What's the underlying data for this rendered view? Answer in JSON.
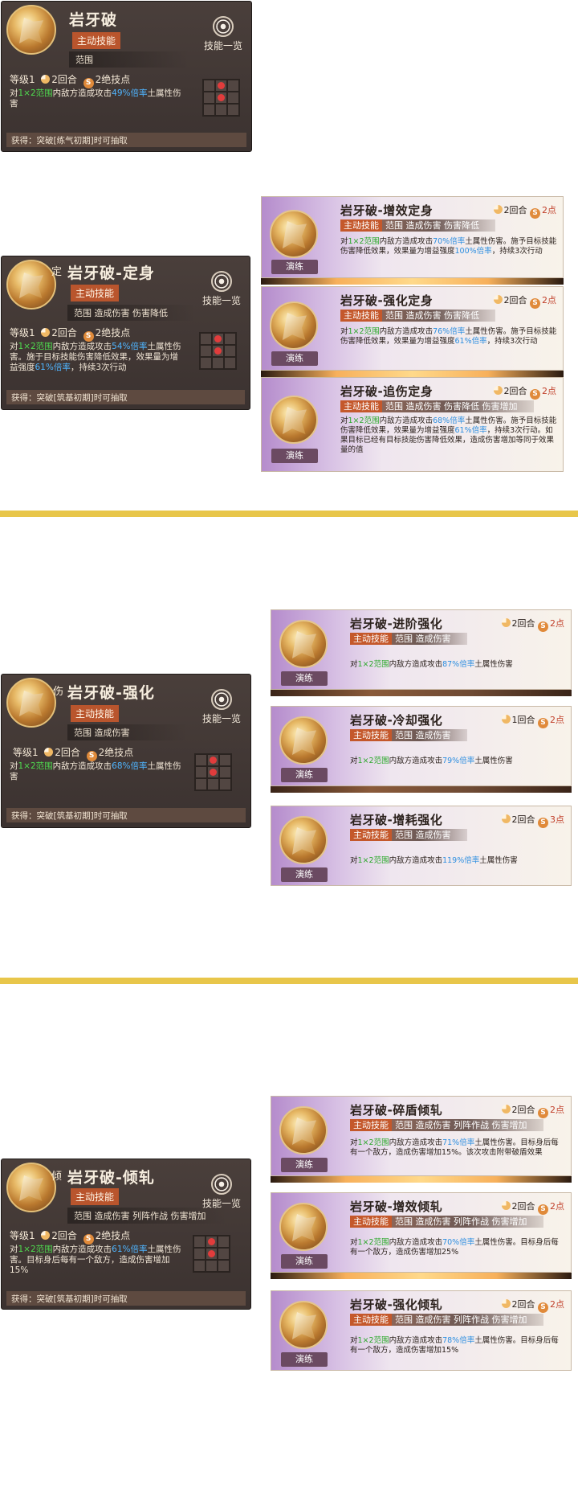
{
  "common": {
    "overview_label": "技能一览",
    "active_label": "主动技能",
    "level_label": "等级1",
    "train_label": "演练"
  },
  "sections": [
    {
      "main": {
        "tag_char": "",
        "title": "岩牙破",
        "range": "范围",
        "range_tags": "",
        "turns": "2回合",
        "points": "2绝技点",
        "desc": {
          "p1": "对",
          "g": "1×2范围",
          "p2": "内敌方造成攻击",
          "b": "49%倍率",
          "p3": "土属性伤害"
        },
        "obtain": "获得：突破[练气初期]时可抽取"
      },
      "variants": []
    },
    {
      "main": {
        "tag_char": "定",
        "title": "岩牙破-定身",
        "range": "范围",
        "range_tags": "造成伤害 伤害降低",
        "turns": "2回合",
        "points": "2绝技点",
        "desc": {
          "p1": "对",
          "g": "1×2范围",
          "p2": "内敌方造成攻击",
          "b": "54%倍率",
          "p3": "土属性伤害。施于目标技能伤害降低效果，效果量为增益强度",
          "b2": "61%倍率",
          "p4": "，持续3次行动"
        },
        "obtain": "获得：突破[筑基初期]时可抽取"
      },
      "variants": [
        {
          "title": "岩牙破-增效定身",
          "turns": "2回合",
          "points": "2点",
          "tags": "范围 造成伤害 伤害降低",
          "desc": {
            "p1": "对",
            "g": "1×2范围",
            "p2": "内敌方造成攻击",
            "b": "70%倍率",
            "p3": "土属性伤害。施予目标技能伤害降低效果，效果量为增益强度",
            "b2": "100%倍率",
            "p4": "，持续3次行动"
          }
        },
        {
          "title": "岩牙破-强化定身",
          "turns": "2回合",
          "points": "2点",
          "tags": "范围 造成伤害 伤害降低",
          "desc": {
            "p1": "对",
            "g": "1×2范围",
            "p2": "内敌方造成攻击",
            "b": "76%倍率",
            "p3": "土属性伤害。施予目标技能伤害降低效果，效果量为增益强度",
            "b2": "61%倍率",
            "p4": "，持续3次行动"
          }
        },
        {
          "title": "岩牙破-追伤定身",
          "turns": "2回合",
          "points": "2点",
          "tags": "范围 造成伤害 伤害降低 伤害增加",
          "desc": {
            "p1": "对",
            "g": "1×2范围",
            "p2": "内敌方造成攻击",
            "b": "68%倍率",
            "p3": "土属性伤害。施予目标技能伤害降低效果，效果量为增益强度",
            "b2": "61%倍率",
            "p4": "，持续3次行动。如果目标已经有目标技能伤害降低效果，造成伤害增加等同于效果量的值"
          }
        }
      ]
    },
    {
      "main": {
        "tag_char": "伤",
        "title": "岩牙破-强化",
        "range": "范围",
        "range_tags": "造成伤害",
        "turns": "2回合",
        "points": "2绝技点",
        "desc": {
          "p1": "对",
          "g": "1×2范围",
          "p2": "内敌方造成攻击",
          "b": "68%倍率",
          "p3": "土属性伤害"
        },
        "obtain": "获得：突破[筑基初期]时可抽取"
      },
      "variants": [
        {
          "title": "岩牙破-进阶强化",
          "turns": "2回合",
          "points": "2点",
          "tags": "范围 造成伤害",
          "desc": {
            "p1": "对",
            "g": "1×2范围",
            "p2": "内敌方造成攻击",
            "b": "87%倍率",
            "p3": "土属性伤害"
          }
        },
        {
          "title": "岩牙破-冷却强化",
          "turns": "1回合",
          "points": "2点",
          "tags": "范围 造成伤害",
          "desc": {
            "p1": "对",
            "g": "1×2范围",
            "p2": "内敌方造成攻击",
            "b": "79%倍率",
            "p3": "土属性伤害"
          }
        },
        {
          "title": "岩牙破-增耗强化",
          "turns": "2回合",
          "points": "3点",
          "tags": "范围 造成伤害",
          "desc": {
            "p1": "对",
            "g": "1×2范围",
            "p2": "内敌方造成攻击",
            "b": "119%倍率",
            "p3": "土属性伤害"
          }
        }
      ]
    },
    {
      "main": {
        "tag_char": "倾",
        "title": "岩牙破-倾轧",
        "range": "范围",
        "range_tags": "造成伤害 列阵作战 伤害增加",
        "turns": "2回合",
        "points": "2绝技点",
        "desc": {
          "p1": "对",
          "g": "1×2范围",
          "p2": "内敌方造成攻击",
          "b": "61%倍率",
          "p3": "土属性伤害。目标身后每有一个敌方，造成伤害增加15%"
        },
        "obtain": "获得：突破[筑基初期]时可抽取"
      },
      "variants": [
        {
          "title": "岩牙破-碎盾倾轧",
          "turns": "2回合",
          "points": "2点",
          "tags": "范围 造成伤害 列阵作战 伤害增加",
          "desc": {
            "p1": "对",
            "g": "1×2范围",
            "p2": "内敌方造成攻击",
            "b": "71%倍率",
            "p3": "土属性伤害。目标身后每有一个敌方，造成伤害增加15%。该次攻击附带破盾效果"
          }
        },
        {
          "title": "岩牙破-增效倾轧",
          "turns": "2回合",
          "points": "2点",
          "tags": "范围 造成伤害 列阵作战 伤害增加",
          "desc": {
            "p1": "对",
            "g": "1×2范围",
            "p2": "内敌方造成攻击",
            "b": "70%倍率",
            "p3": "土属性伤害。目标身后每有一个敌方，造成伤害增加25%"
          }
        },
        {
          "title": "岩牙破-强化倾轧",
          "turns": "2回合",
          "points": "2点",
          "tags": "范围 造成伤害 列阵作战 伤害增加",
          "desc": {
            "p1": "对",
            "g": "1×2范围",
            "p2": "内敌方造成攻击",
            "b": "78%倍率",
            "p3": "土属性伤害。目标身后每有一个敌方，造成伤害增加15%"
          }
        }
      ]
    }
  ]
}
